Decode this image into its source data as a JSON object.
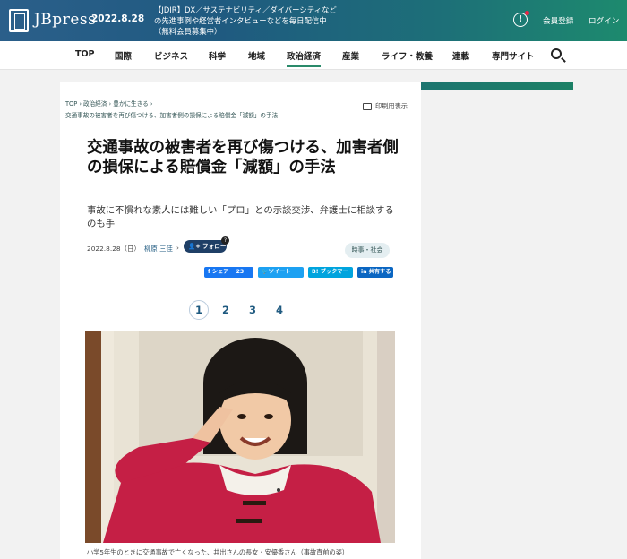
{
  "header": {
    "logo": "JBpress",
    "date": "2022.8.28",
    "promo": "【JDIR】DX／サステナビリティ／ダイバーシティなどの先進事例や経営者インタビューなどを毎日配信中（無料会員募集中）",
    "member_register": "会員登録",
    "login": "ログイン"
  },
  "nav": {
    "items": [
      "TOP",
      "国際",
      "ビジネス",
      "科学",
      "地域",
      "政治経済",
      "産業",
      "ライフ・教養",
      "連載",
      "専門サイト"
    ],
    "active": "政治経済"
  },
  "breadcrumb": {
    "items": [
      "TOP",
      "政治経済",
      "豊かに生きる"
    ],
    "current": "交通事故の被害者を再び傷つける、加害者側の損保による賠償金「減額」の手法"
  },
  "print_label": "印刷用表示",
  "article": {
    "title": "交通事故の被害者を再び傷つける、加害者側の損保による賠償金「減額」の手法",
    "subtitle": "事故に不慣れな素人には難しい「プロ」との示談交渉、弁護士に相談するのも手",
    "date": "2022.8.28（日）",
    "author": "柳原 三佳",
    "follow_label": "フォロー",
    "follow_help": "?",
    "category_tag": "時事・社会"
  },
  "share": {
    "facebook_label": "シェア",
    "facebook_count": "23",
    "twitter_label": "ツイート",
    "hatena_label": "ブックマーク",
    "linkedin_label": "共有する"
  },
  "pagination": {
    "pages": [
      "1",
      "2",
      "3",
      "4"
    ],
    "current": "1"
  },
  "photo": {
    "caption": "小学5年生のときに交通事故で亡くなった、井出さんの長女・安優香さん（事故直前の姿）"
  },
  "colors": {
    "header_start": "#2b5f8a",
    "header_end": "#1d8a6e",
    "accent": "#1f5a80",
    "facebook": "#1877f2",
    "twitter": "#1da1f2",
    "hatena": "#00a4de",
    "linkedin": "#0a66c2"
  }
}
